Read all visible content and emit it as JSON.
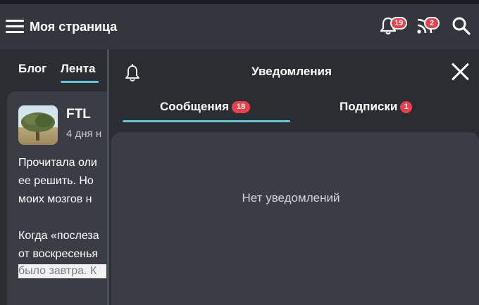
{
  "header": {
    "title": "Моя страница",
    "notifications_count": "19",
    "feed_count": "2"
  },
  "feed_tabs": [
    {
      "label": "Блог",
      "active": false
    },
    {
      "label": "Лента",
      "active": true
    }
  ],
  "post": {
    "author": "FTL",
    "date": "4 дня н",
    "lines": [
      "Прочитала оли",
      "ее решить. Но",
      "моих мозгов н",
      "Когда «послеза",
      "от воскресенья",
      "было завтра. К"
    ]
  },
  "notifications": {
    "title": "Уведомления",
    "tabs": [
      {
        "label": "Сообщения",
        "badge": "18",
        "active": true
      },
      {
        "label": "Подписки",
        "badge": "1",
        "active": false
      }
    ],
    "empty_text": "Нет уведомлений"
  },
  "colors": {
    "accent": "#63c6dc",
    "badge": "#e8414c",
    "background": "#2a2e33",
    "card": "#3a3e44"
  },
  "icons": [
    "menu-icon",
    "bell-icon",
    "rss-icon",
    "search-icon",
    "close-icon"
  ]
}
